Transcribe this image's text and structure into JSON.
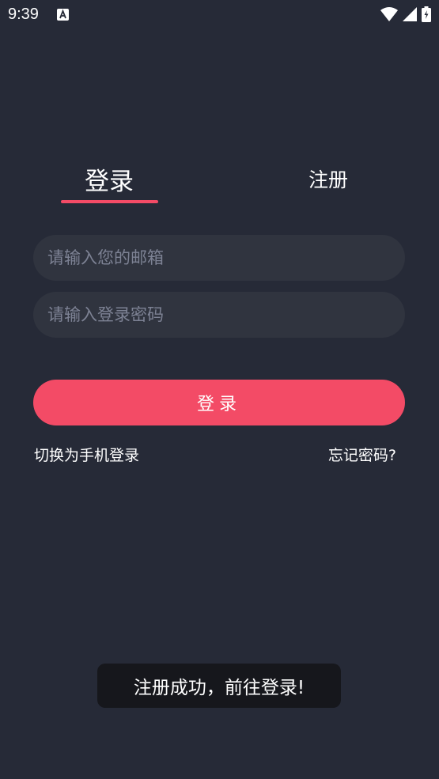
{
  "status_bar": {
    "time": "9:39",
    "notification_icon": "text-a-icon",
    "icons": [
      "wifi-icon",
      "cellular-signal-icon",
      "battery-charging-icon"
    ]
  },
  "tabs": {
    "login": "登录",
    "register": "注册",
    "active": "login"
  },
  "form": {
    "email_placeholder": "请输入您的邮箱",
    "email_value": "",
    "password_placeholder": "请输入登录密码",
    "password_value": "",
    "submit_label": "登录"
  },
  "links": {
    "switch_to_phone": "切换为手机登录",
    "forgot_password": "忘记密码?"
  },
  "toast": {
    "message": "注册成功，前往登录!"
  },
  "colors": {
    "background": "#262a37",
    "input_background": "#30343f",
    "accent": "#f34b66",
    "toast_background": "#16171c",
    "placeholder": "#7d8294"
  }
}
